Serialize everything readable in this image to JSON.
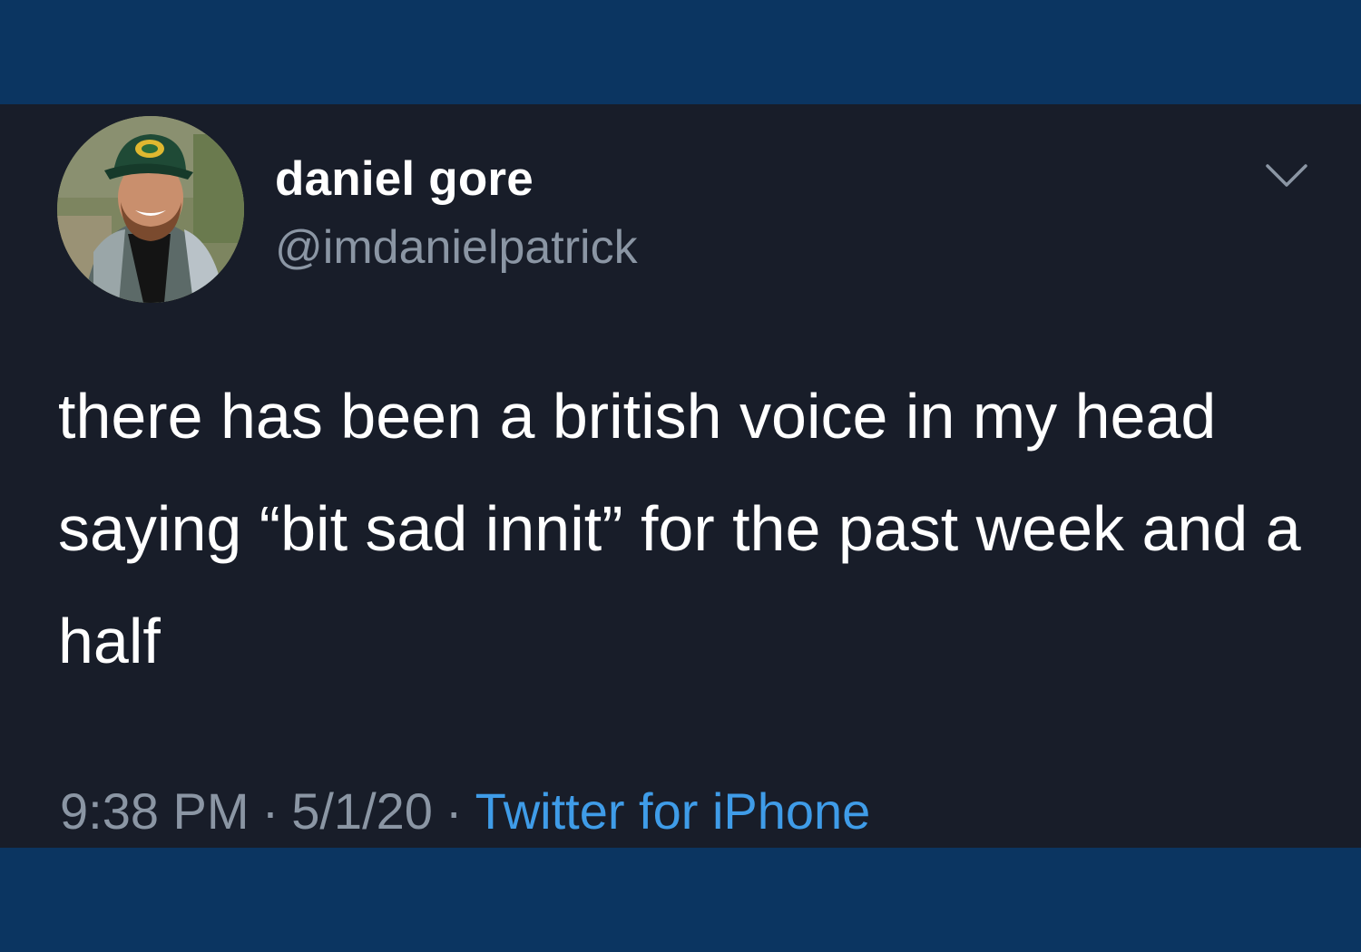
{
  "tweet": {
    "author": {
      "display_name": "daniel gore",
      "handle": "@imdanielpatrick"
    },
    "text": "there has been a british voice in my head saying “bit sad innit” for the past week and a half",
    "meta": {
      "time": "9:38 PM",
      "separator": "·",
      "date": "5/1/20",
      "source": "Twitter for iPhone"
    }
  },
  "icons": {
    "more": "chevron-down-icon",
    "avatar": "profile-photo"
  },
  "colors": {
    "frame": "#0b3561",
    "card": "#181d29",
    "text_primary": "#ffffff",
    "text_secondary": "#8b96a4",
    "link": "#3f9ce8"
  }
}
